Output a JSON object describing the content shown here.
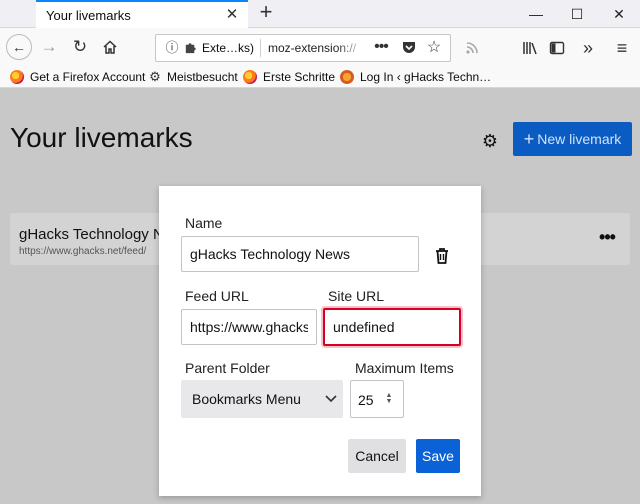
{
  "browser": {
    "tab_title": "Your livemarks",
    "tab_close": "✕",
    "new_tab": "+",
    "window_controls": {
      "minimize": "—",
      "maximize": "☐",
      "close": "✕"
    },
    "url_extension_label": "Exte…ks)",
    "url_text": "moz-extension://",
    "page_actions_glyph": "•••",
    "icons": [
      "back-arrow-icon",
      "forward-arrow-icon",
      "reload-icon",
      "home-icon",
      "info-icon",
      "extension-puzzle-icon",
      "pocket-icon",
      "star-icon",
      "rss-icon",
      "library-icon",
      "sidebar-icon",
      "overflow-chevrons-icon",
      "hamburger-menu-icon"
    ]
  },
  "bookmarks": [
    {
      "label": "Get a Firefox Account",
      "icon": "firefox-icon"
    },
    {
      "label": "Meistbesucht",
      "icon": "gear-icon"
    },
    {
      "label": "Erste Schritte",
      "icon": "firefox-icon"
    },
    {
      "label": "Log In ‹ gHacks Techn…",
      "icon": "ghacks-icon"
    }
  ],
  "page": {
    "title": "Your livemarks",
    "new_button": "New livemark",
    "feed": {
      "title": "gHacks Technology News",
      "url": "https://www.ghacks.net/feed/"
    }
  },
  "dialog": {
    "name_label": "Name",
    "name_value": "gHacks Technology News",
    "feed_url_label": "Feed URL",
    "feed_url_value": "https://www.ghacks.net/feed/",
    "site_url_label": "Site URL",
    "site_url_value": "undefined",
    "parent_folder_label": "Parent Folder",
    "parent_folder_value": "Bookmarks Menu",
    "max_items_label": "Maximum Items",
    "max_items_value": "25",
    "cancel_label": "Cancel",
    "save_label": "Save"
  },
  "colors": {
    "accent": "#0a62d6",
    "error_border": "#d70022",
    "overlay_background": "#c8c8c8"
  }
}
